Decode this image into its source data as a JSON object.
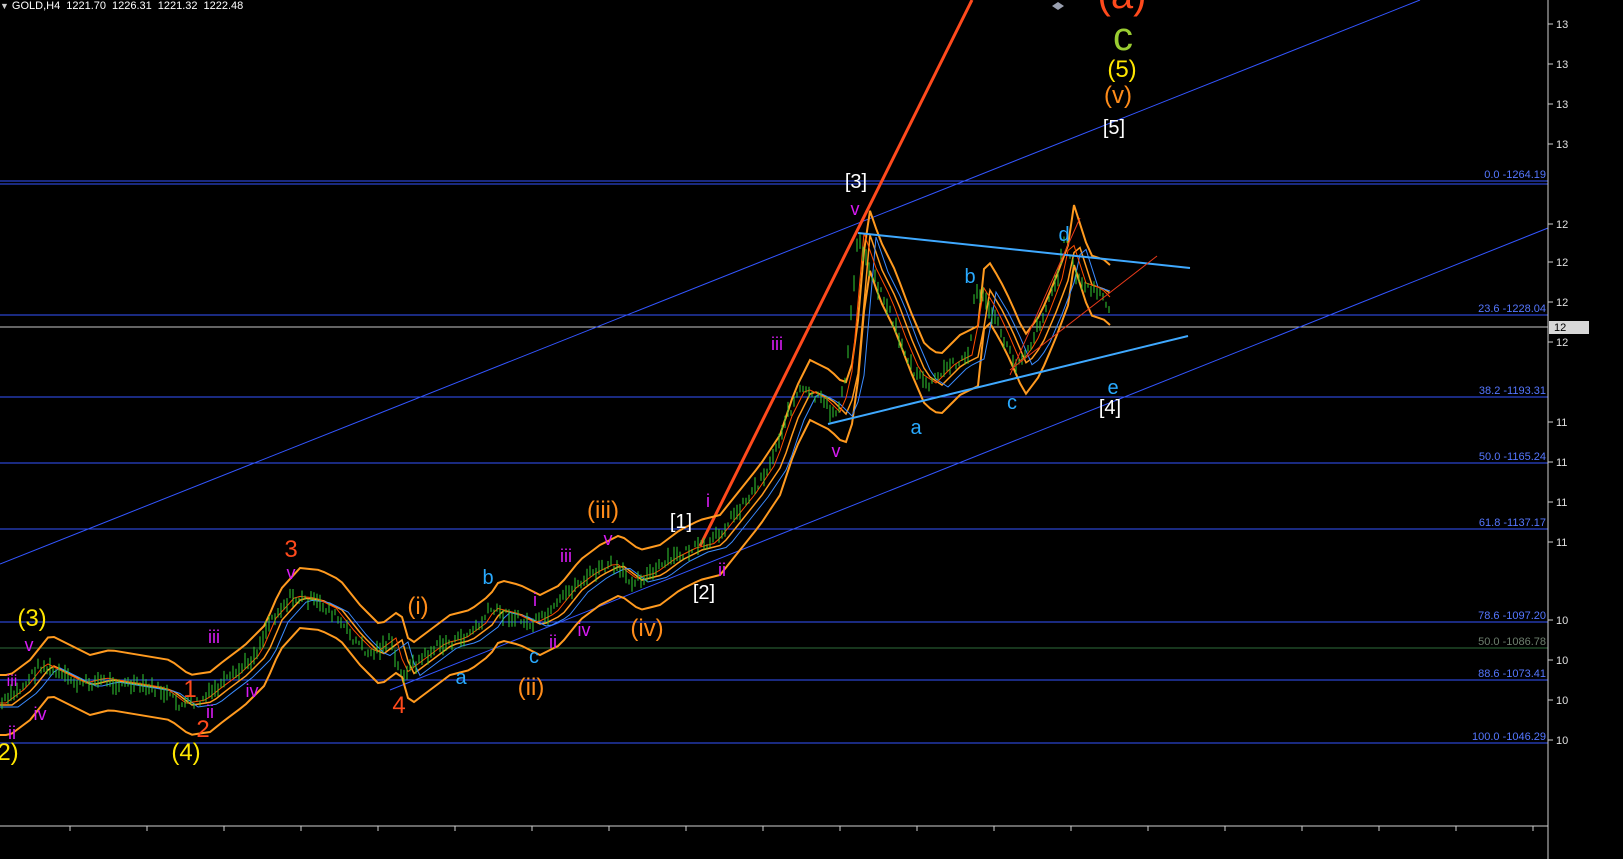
{
  "header": {
    "symbol": "GOLD,H4",
    "open": "1221.70",
    "high": "1226.31",
    "low": "1221.32",
    "close": "1222.48"
  },
  "colors": {
    "background": "#000000",
    "bar": "#32CD32",
    "ma_fast": "#FF4D00",
    "ma_slow": "#3A8BFF",
    "band": "#FF9A1F",
    "channel": "#3355FF",
    "triangle": "#3FA9FF",
    "orange_trend": "#FF4A1C",
    "fib_label": "#5577FF",
    "wave_white": "#FFFFFF",
    "wave_orange": "#FF8C1A",
    "wave_yellow": "#FFE600",
    "wave_magenta": "#D81BF5",
    "wave_cyan": "#29AAFF",
    "wave_red": "#FF4A1C",
    "wave_green": "#9ACD32"
  },
  "fib_levels": [
    {
      "label": "0.0 -1264.19"
    },
    {
      "label": "23.6 -1228.04"
    },
    {
      "label": "38.2 -1193.31"
    },
    {
      "label": "50.0 -1165.24"
    },
    {
      "label": "61.8 -1137.17"
    },
    {
      "label": "78.6 -1097.20"
    },
    {
      "label": "50.0 -1086.78"
    },
    {
      "label": "88.6 -1073.41"
    },
    {
      "label": "100.0 -1046.29"
    }
  ],
  "current_price_tag": "12",
  "price_axis_ticks": [
    "13",
    "13",
    "13",
    "13",
    "12",
    "12",
    "12",
    "12",
    "11",
    "11",
    "11",
    "11",
    "10",
    "10",
    "10",
    "10"
  ],
  "wave_labels": [
    {
      "text": "(a)",
      "color": "wave_red"
    },
    {
      "text": "c",
      "color": "wave_green"
    },
    {
      "text": "(5)",
      "color": "wave_yellow"
    },
    {
      "text": "(v)",
      "color": "wave_orange"
    },
    {
      "text": "[5]",
      "color": "wave_white"
    },
    {
      "text": "[3]",
      "color": "wave_white"
    },
    {
      "text": "v",
      "color": "wave_magenta"
    },
    {
      "text": "d",
      "color": "wave_cyan"
    },
    {
      "text": "b",
      "color": "wave_cyan"
    },
    {
      "text": "iii",
      "color": "wave_magenta"
    },
    {
      "text": "e",
      "color": "wave_cyan"
    },
    {
      "text": "c",
      "color": "wave_cyan"
    },
    {
      "text": "[4]",
      "color": "wave_white"
    },
    {
      "text": "a",
      "color": "wave_cyan"
    },
    {
      "text": "v",
      "color": "wave_magenta"
    },
    {
      "text": "i",
      "color": "wave_magenta"
    },
    {
      "text": "[1]",
      "color": "wave_white"
    },
    {
      "text": "(iii)",
      "color": "wave_orange"
    },
    {
      "text": "v",
      "color": "wave_magenta"
    },
    {
      "text": "iii",
      "color": "wave_magenta"
    },
    {
      "text": "ii",
      "color": "wave_magenta"
    },
    {
      "text": "[2]",
      "color": "wave_white"
    },
    {
      "text": "3",
      "color": "wave_red"
    },
    {
      "text": "v",
      "color": "wave_magenta"
    },
    {
      "text": "b",
      "color": "wave_cyan"
    },
    {
      "text": "i",
      "color": "wave_magenta"
    },
    {
      "text": "(3)",
      "color": "wave_yellow"
    },
    {
      "text": "v",
      "color": "wave_magenta"
    },
    {
      "text": "iii",
      "color": "wave_magenta"
    },
    {
      "text": "(i)",
      "color": "wave_orange"
    },
    {
      "text": "iv",
      "color": "wave_magenta"
    },
    {
      "text": "(iv)",
      "color": "wave_orange"
    },
    {
      "text": "ii",
      "color": "wave_magenta"
    },
    {
      "text": "c",
      "color": "wave_cyan"
    },
    {
      "text": "iii",
      "color": "wave_magenta"
    },
    {
      "text": "a",
      "color": "wave_cyan"
    },
    {
      "text": "1",
      "color": "wave_red"
    },
    {
      "text": "iv",
      "color": "wave_magenta"
    },
    {
      "text": "iv",
      "color": "wave_magenta"
    },
    {
      "text": "(ii)",
      "color": "wave_orange"
    },
    {
      "text": "4",
      "color": "wave_red"
    },
    {
      "text": "2",
      "color": "wave_red"
    },
    {
      "text": "ii",
      "color": "wave_magenta"
    },
    {
      "text": "ii",
      "color": "wave_magenta"
    },
    {
      "text": "(4)",
      "color": "wave_yellow"
    },
    {
      "text": "2)",
      "color": "wave_yellow"
    }
  ]
}
